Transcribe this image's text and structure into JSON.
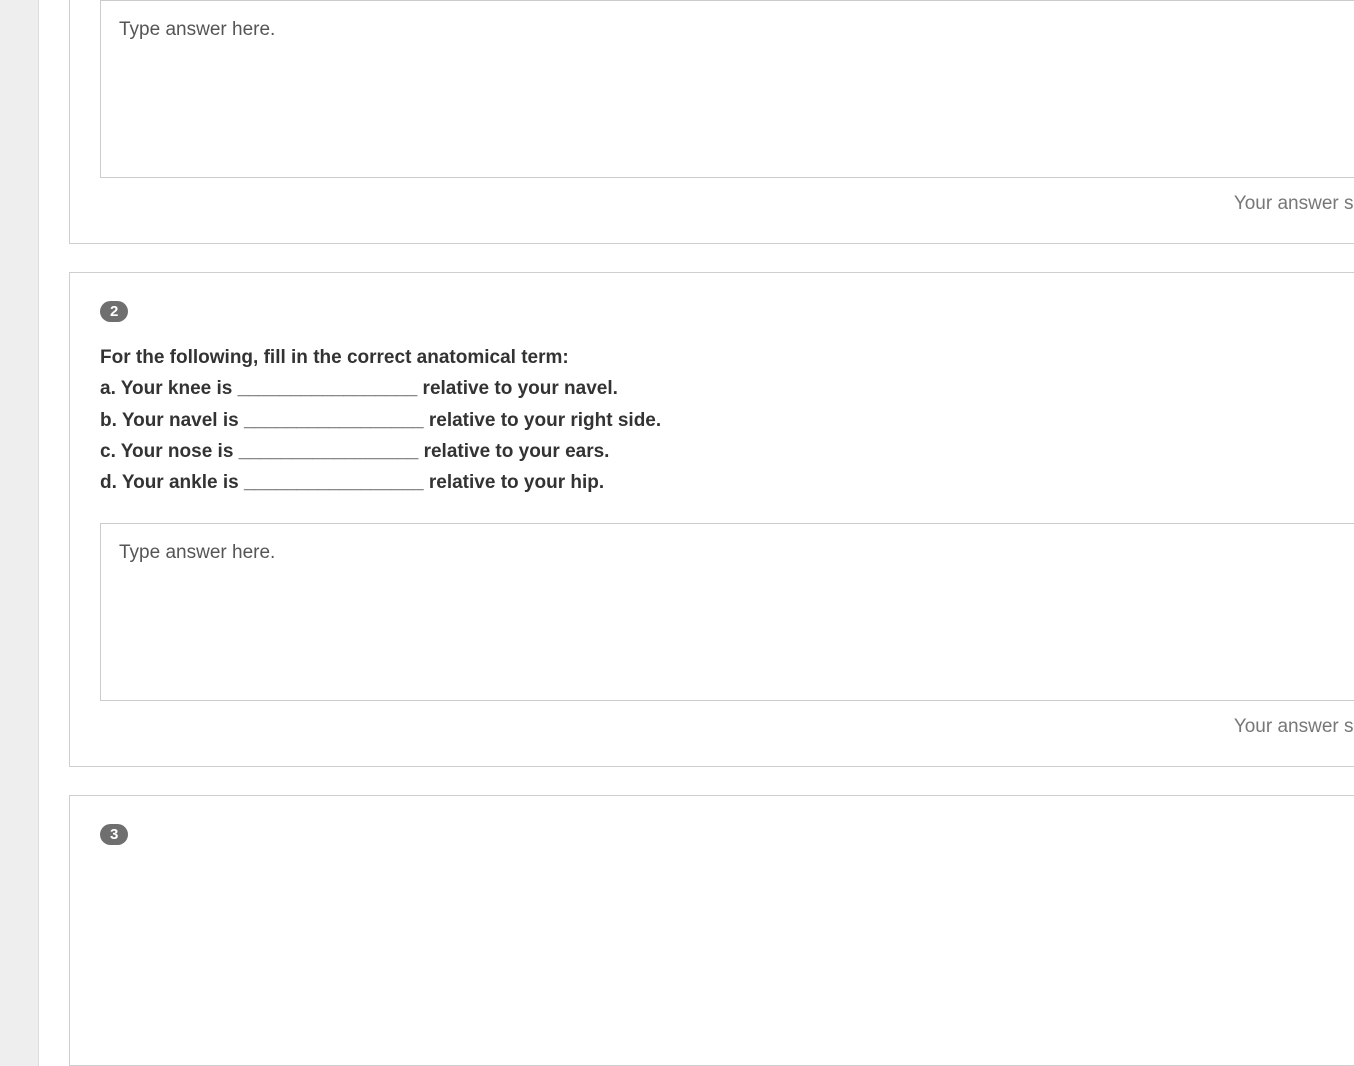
{
  "questions": [
    {
      "number": "",
      "prompt": "",
      "answer_placeholder": "Type answer here.",
      "hint": "Your answer should"
    },
    {
      "number": "2",
      "prompt": "For the following, fill in the correct anatomical term:\na. Your knee is _________________ relative to your navel.\nb. Your navel is _________________ relative to your right side.\nc. Your nose is _________________ relative to your ears.\nd. Your ankle is _________________ relative to your hip.",
      "answer_placeholder": "Type answer here.",
      "hint": "Your answer should"
    },
    {
      "number": "3",
      "prompt": "",
      "answer_placeholder": "",
      "hint": ""
    }
  ]
}
